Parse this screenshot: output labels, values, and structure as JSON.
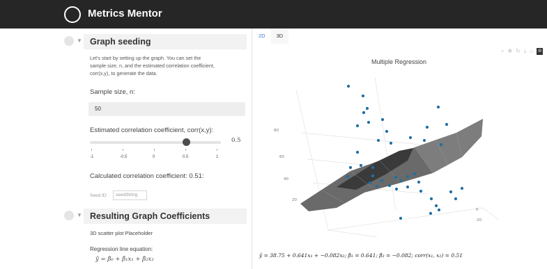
{
  "app": {
    "title": "Metrics Mentor"
  },
  "graph_seeding": {
    "title": "Graph seeding",
    "description_1": "Let's start by setting up the graph. You can set the",
    "description_2": "sample size, n, and the estimated correlation coefficient,",
    "description_3": "corr(x,y), to generate the data.",
    "sample_size_label": "Sample size, n:",
    "sample_size_value": "50",
    "corr_label": "Estimated correlation coefficient, corr(x,y):",
    "slider_value": "0.5",
    "slider_fraction": 0.75,
    "ticks": [
      "-1",
      "-0.5",
      "0",
      "0.5",
      "1"
    ],
    "calculated": "Calculated correlation coefficient: 0.51:",
    "seed_label": "Seed ID:",
    "seed_placeholder": "seedString"
  },
  "coefficients": {
    "title": "Resulting Graph Coefficients",
    "placeholder": "3D scatter plot Placeholder",
    "regression_label": "Regression line equation:",
    "regression_eq": "ŷ = β̂₀ + β̂₁x₁ + β̂₂x₂"
  },
  "tabs": [
    "2D",
    "3D"
  ],
  "active_tab": "3D",
  "toolbar_icons": [
    "zoom-icon",
    "pan-icon",
    "rotate-icon",
    "download-icon",
    "home-icon",
    "plotly-logo-icon"
  ],
  "chart": {
    "title": "Multiple Regression",
    "axis_ticks_left": [
      "80",
      "60",
      "40",
      "20"
    ],
    "axis_ticks_right": [
      "0",
      "20"
    ],
    "equation": "ŷ = 38.75 + 0.641x₁ + −0.082x₂;    β̂₁ = 0.641; β̂₂ = −0.082;    corr(x₁, x₂) = 0.51"
  },
  "colors": {
    "topbar": "#262626",
    "points": "#1f6fa5",
    "surface": "#6f6f6f",
    "accent": "#3a7bd5"
  }
}
